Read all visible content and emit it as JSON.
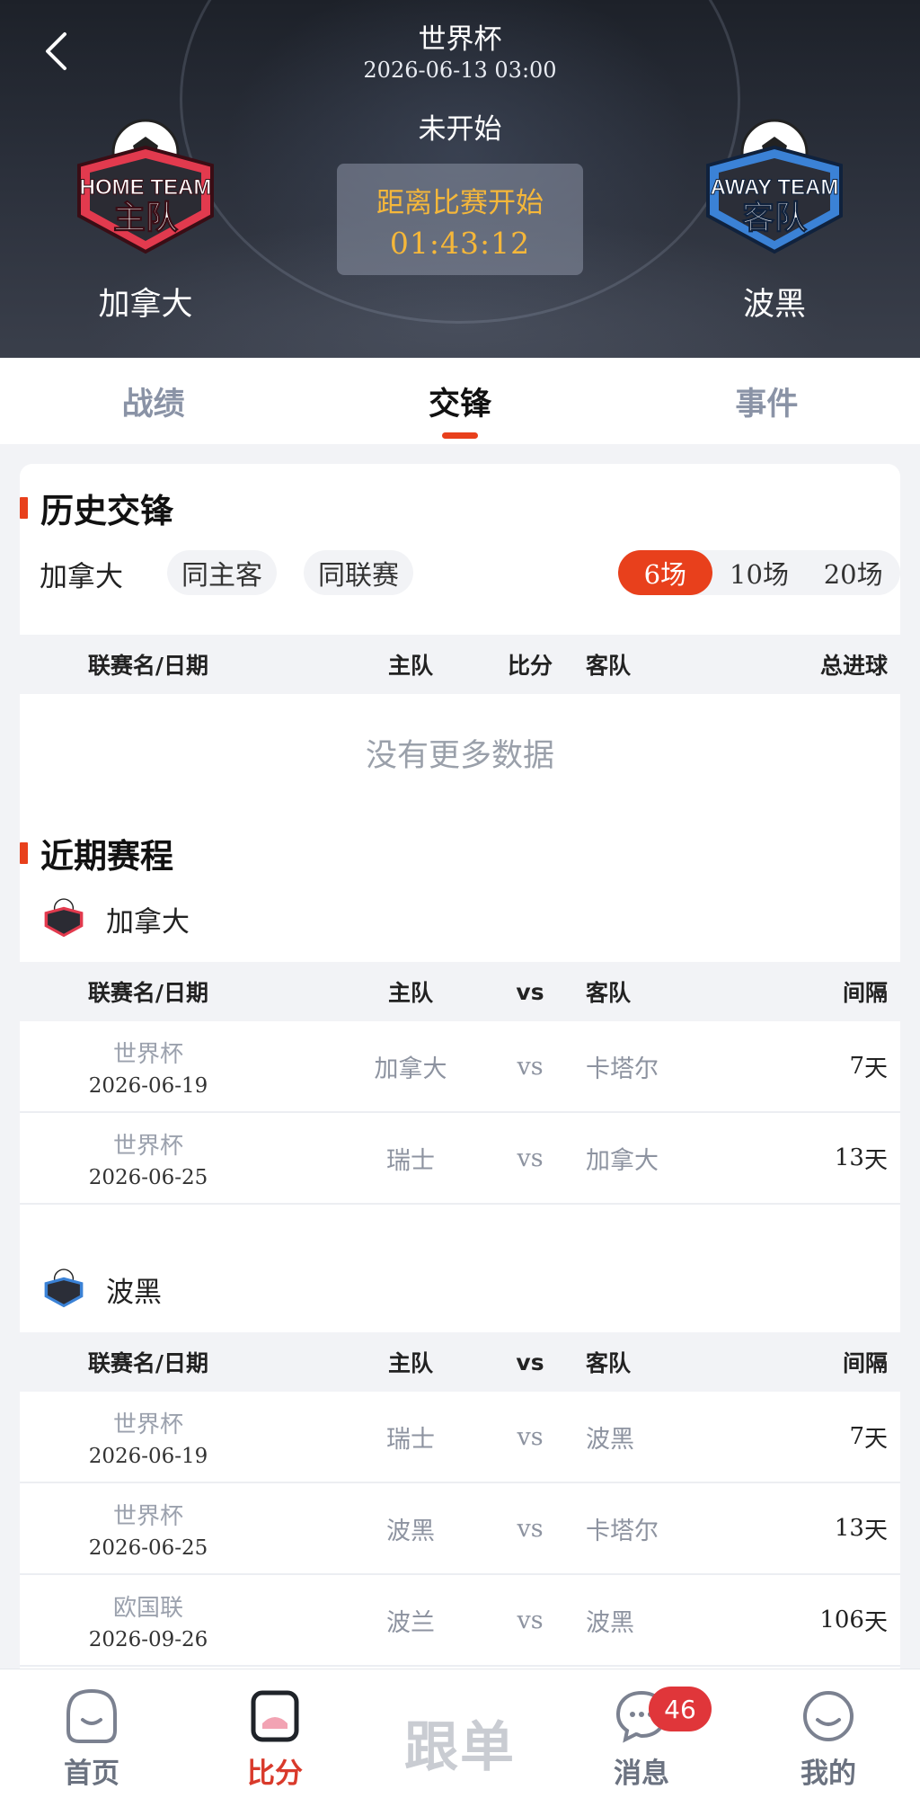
{
  "header": {
    "league": "世界杯",
    "datetime": "2026-06-13 03:00",
    "status": "未开始",
    "countdown_label": "距离比赛开始",
    "countdown_value": "01:43:12",
    "home_team": "加拿大",
    "away_team": "波黑",
    "home_badge_text": {
      "line1": "HOME TEAM",
      "line2": "主队"
    },
    "away_badge_text": {
      "line1": "AWAY TEAM",
      "line2": "客队"
    }
  },
  "tabs": [
    {
      "label": "战绩",
      "active": false
    },
    {
      "label": "交锋",
      "active": true
    },
    {
      "label": "事件",
      "active": false
    }
  ],
  "h2h": {
    "title": "历史交锋",
    "team": "加拿大",
    "chips": [
      "同主客",
      "同联赛"
    ],
    "counts": [
      "6场",
      "10场",
      "20场"
    ],
    "active_count": 0,
    "columns": [
      "联赛名/日期",
      "主队",
      "比分",
      "客队",
      "总进球"
    ],
    "empty": "没有更多数据"
  },
  "recent": {
    "title": "近期赛程",
    "columns": [
      "联赛名/日期",
      "主队",
      "vs",
      "客队",
      "间隔"
    ],
    "home": {
      "team": "加拿大",
      "rows": [
        {
          "league": "世界杯",
          "date": "2026-06-19",
          "home": "加拿大",
          "vs": "vs",
          "away": "卡塔尔",
          "gap_num": "7",
          "gap_unit": "天"
        },
        {
          "league": "世界杯",
          "date": "2026-06-25",
          "home": "瑞士",
          "vs": "vs",
          "away": "加拿大",
          "gap_num": "13",
          "gap_unit": "天"
        }
      ]
    },
    "away": {
      "team": "波黑",
      "rows": [
        {
          "league": "世界杯",
          "date": "2026-06-19",
          "home": "瑞士",
          "vs": "vs",
          "away": "波黑",
          "gap_num": "7",
          "gap_unit": "天"
        },
        {
          "league": "世界杯",
          "date": "2026-06-25",
          "home": "波黑",
          "vs": "vs",
          "away": "卡塔尔",
          "gap_num": "13",
          "gap_unit": "天"
        },
        {
          "league": "欧国联",
          "date": "2026-09-26",
          "home": "波兰",
          "vs": "vs",
          "away": "波黑",
          "gap_num": "106",
          "gap_unit": "天"
        }
      ]
    }
  },
  "bottom_nav": {
    "items": [
      {
        "label": "首页",
        "icon": "home-face-icon"
      },
      {
        "label": "比分",
        "icon": "score-cup-icon",
        "active": true
      },
      {
        "label": "跟单",
        "icon": "follow-text-icon"
      },
      {
        "label": "消息",
        "icon": "chat-bubble-icon"
      },
      {
        "label": "我的",
        "icon": "smile-face-icon"
      }
    ],
    "message_badge": "46"
  },
  "colors": {
    "accent": "#e8401c",
    "countdown_text": "#f5b73a",
    "header_bg": "#252a33",
    "active_nav": "#d93a2b",
    "badge": "#e0363a"
  }
}
